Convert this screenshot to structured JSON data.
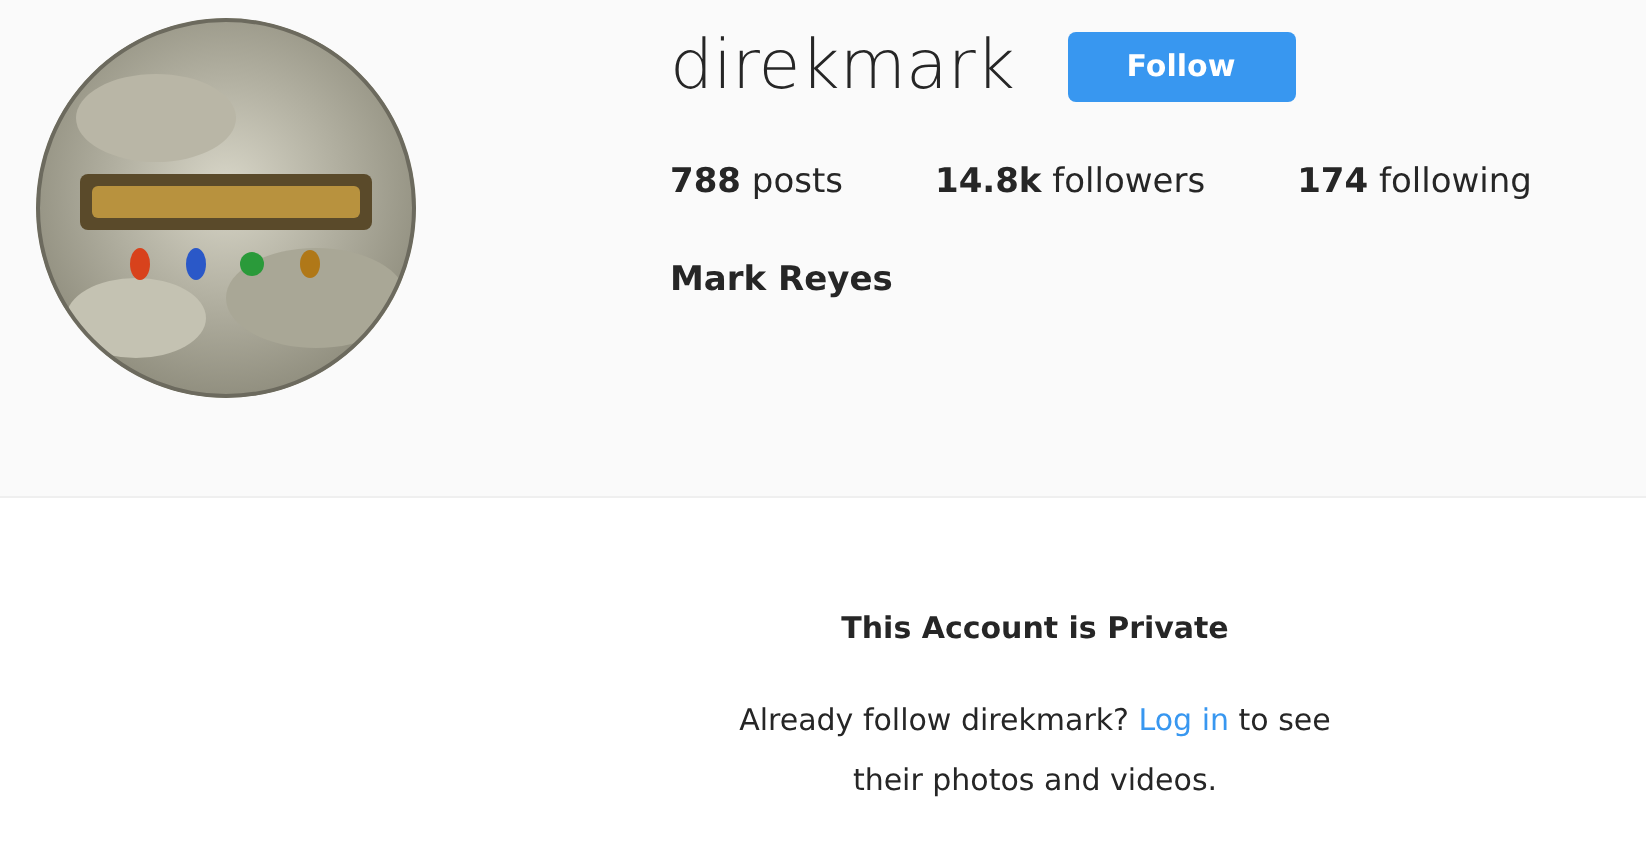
{
  "profile": {
    "username": "direkmark",
    "follow_button": "Follow",
    "stats": [
      "**788** posts",
      "**14.8k** followers",
      "**174** following"
    ],
    "full_name": "Mark Reyes"
  },
  "private_notice": {
    "title": "This Account is Private",
    "text_before": "Already follow direkmark? ",
    "link": "Log in",
    "text_after": " to see their photos and videos."
  }
}
